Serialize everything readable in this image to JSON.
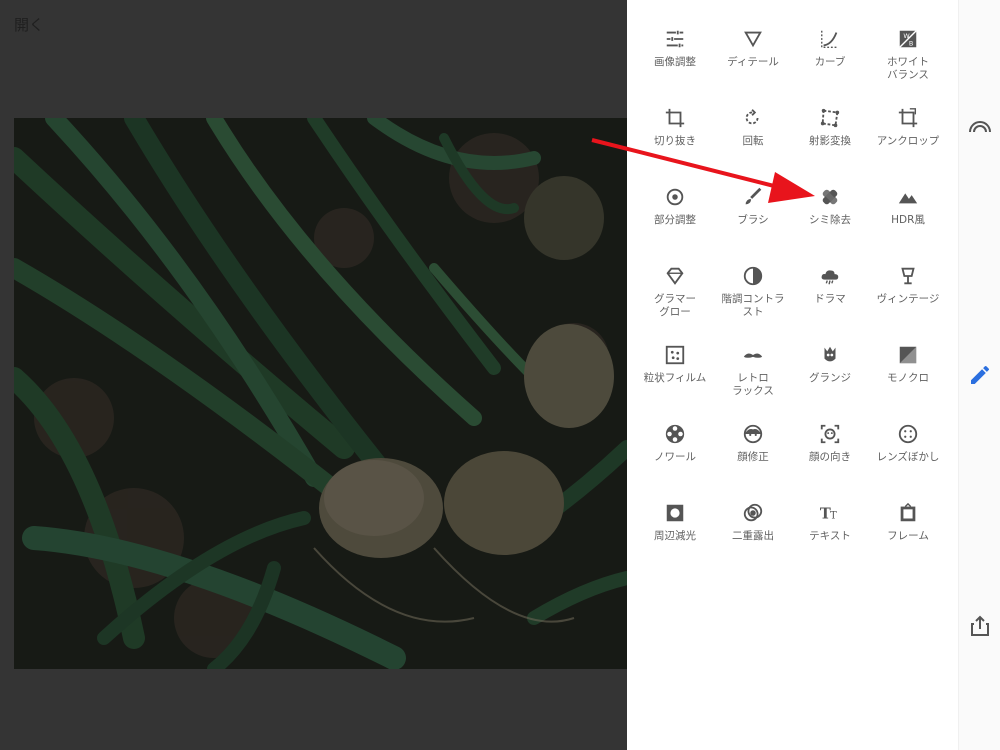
{
  "header": {
    "open_label": "開く"
  },
  "tools": [
    {
      "label": "画像調整",
      "icon": "tune-sliders-icon"
    },
    {
      "label": "ディテール",
      "icon": "triangle-detail-icon"
    },
    {
      "label": "カーブ",
      "icon": "curve-icon"
    },
    {
      "label": "ホワイト\nバランス",
      "icon": "white-balance-icon"
    },
    {
      "label": "切り抜き",
      "icon": "crop-icon"
    },
    {
      "label": "回転",
      "icon": "rotate-icon"
    },
    {
      "label": "射影変換",
      "icon": "perspective-icon"
    },
    {
      "label": "アンクロップ",
      "icon": "expand-icon"
    },
    {
      "label": "部分調整",
      "icon": "selective-icon"
    },
    {
      "label": "ブラシ",
      "icon": "brush-icon"
    },
    {
      "label": "シミ除去",
      "icon": "healing-icon"
    },
    {
      "label": "HDR風",
      "icon": "mountain-icon"
    },
    {
      "label": "グラマー\nグロー",
      "icon": "diamond-icon"
    },
    {
      "label": "階調コントラ\nスト",
      "icon": "tonal-contrast-icon"
    },
    {
      "label": "ドラマ",
      "icon": "cloud-icon"
    },
    {
      "label": "ヴィンテージ",
      "icon": "lamp-icon"
    },
    {
      "label": "粒状フィルム",
      "icon": "grain-icon"
    },
    {
      "label": "レトロ\nラックス",
      "icon": "mustache-icon"
    },
    {
      "label": "グランジ",
      "icon": "grunge-icon"
    },
    {
      "label": "モノクロ",
      "icon": "monochrome-icon"
    },
    {
      "label": "ノワール",
      "icon": "film-reel-icon"
    },
    {
      "label": "顔修正",
      "icon": "face-icon"
    },
    {
      "label": "顔の向き",
      "icon": "face-pose-icon"
    },
    {
      "label": "レンズぼかし",
      "icon": "lens-blur-icon"
    },
    {
      "label": "周辺減光",
      "icon": "vignette-icon"
    },
    {
      "label": "二重露出",
      "icon": "double-exposure-icon"
    },
    {
      "label": "テキスト",
      "icon": "text-icon"
    },
    {
      "label": "フレーム",
      "icon": "frame-icon"
    }
  ],
  "rail": {
    "looks_icon": "rainbow-looks-icon",
    "tools_icon": "pencil-icon",
    "export_icon": "share-icon"
  },
  "colors": {
    "accent": "#2b6fdf",
    "annotation": "#e8141c",
    "tool_icon": "#555555",
    "tool_label": "#616161"
  }
}
